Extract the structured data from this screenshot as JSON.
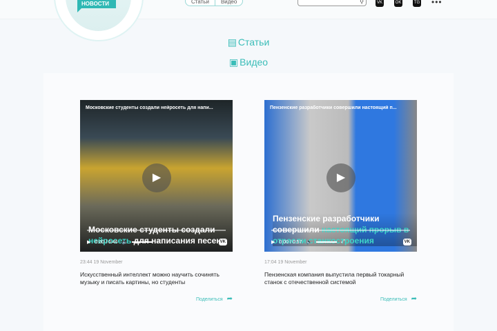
{
  "header": {
    "logo_text": "НОВОСТИ",
    "nav": [
      "Статьи",
      "Видео"
    ],
    "search_placeholder": "",
    "social": [
      "VK",
      "OK",
      "TG"
    ],
    "more": "•••"
  },
  "sections": {
    "articles": "Статьи",
    "videos": "Видео"
  },
  "cards": [
    {
      "video_title": "Московские студенты создали нейросеть для напи...",
      "caption_plain": "Московские студенты создали ",
      "caption_accent": "нейросеть",
      "caption_rest": " для написания песен",
      "time_display": "0:00 / 0:46",
      "timestamp": "23:44 19 November",
      "desc": "Искусственный интеллект можно научить сочинять музыку и писать картины, но студенты",
      "share": "Поделиться"
    },
    {
      "video_title": "Пензенские разработчики совершили настоящий п...",
      "caption_plain": "Пензенские разработчики совершили ",
      "caption_accent": "настоящий прорыв в отрасли станкостроения",
      "caption_rest": "",
      "time_display": "0:00 / 0:57",
      "timestamp": "17:04 19 November",
      "desc": "Пензенская компания выпустила первый токарный станок с отечественной системой",
      "share": "Поделиться"
    }
  ]
}
